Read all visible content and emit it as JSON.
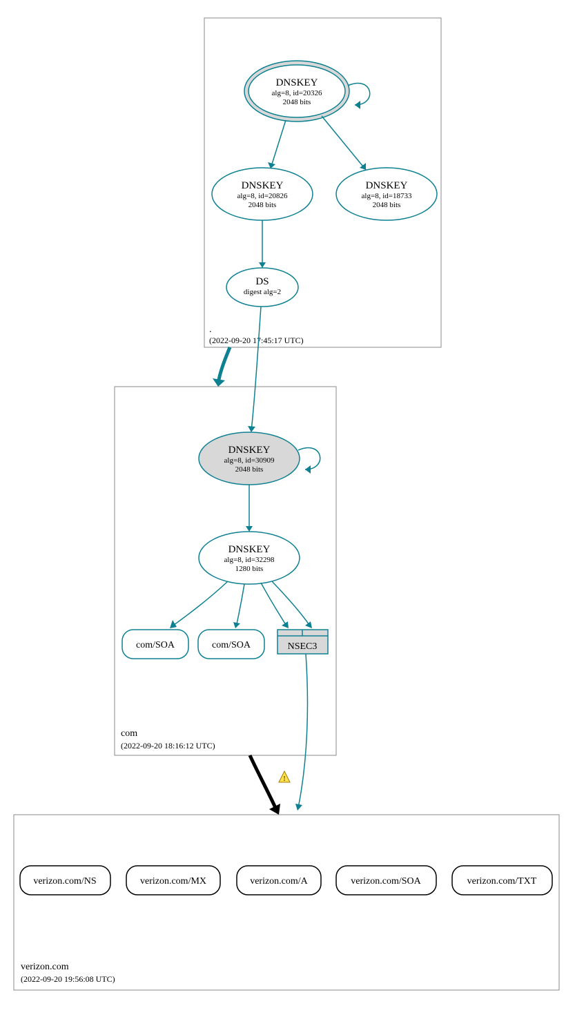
{
  "colors": {
    "teal": "#0d8091",
    "grey": "#d8d8d8",
    "black": "#000"
  },
  "zones": {
    "root": {
      "label": ".",
      "timestamp": "(2022-09-20 17:45:17 UTC)"
    },
    "com": {
      "label": "com",
      "timestamp": "(2022-09-20 18:16:12 UTC)"
    },
    "verizon": {
      "label": "verizon.com",
      "timestamp": "(2022-09-20 19:56:08 UTC)"
    }
  },
  "nodes": {
    "root_ksk": {
      "title": "DNSKEY",
      "l2": "alg=8, id=20326",
      "l3": "2048 bits"
    },
    "root_zsk1": {
      "title": "DNSKEY",
      "l2": "alg=8, id=20826",
      "l3": "2048 bits"
    },
    "root_zsk2": {
      "title": "DNSKEY",
      "l2": "alg=8, id=18733",
      "l3": "2048 bits"
    },
    "ds": {
      "title": "DS",
      "l2": "digest alg=2"
    },
    "com_ksk": {
      "title": "DNSKEY",
      "l2": "alg=8, id=30909",
      "l3": "2048 bits"
    },
    "com_zsk": {
      "title": "DNSKEY",
      "l2": "alg=8, id=32298",
      "l3": "1280 bits"
    },
    "com_soa1": "com/SOA",
    "com_soa2": "com/SOA",
    "nsec3": "NSEC3",
    "v_ns": "verizon.com/NS",
    "v_mx": "verizon.com/MX",
    "v_a": "verizon.com/A",
    "v_soa": "verizon.com/SOA",
    "v_txt": "verizon.com/TXT"
  },
  "warning_icon": "⚠"
}
